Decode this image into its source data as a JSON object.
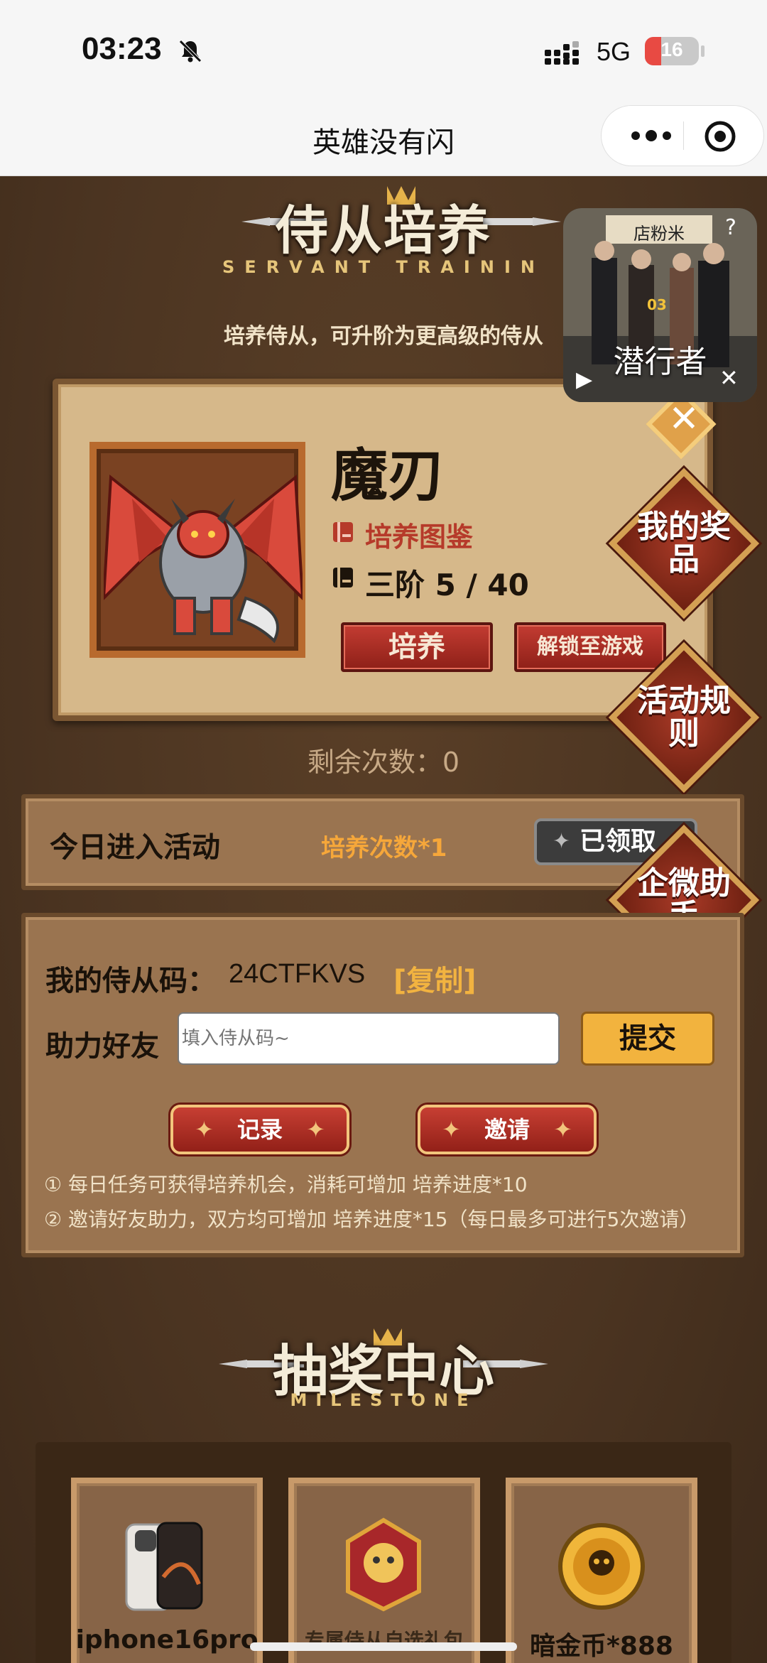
{
  "status": {
    "time": "03:23",
    "network": "5G",
    "battery": "16",
    "battery_level": 0.16
  },
  "nav": {
    "title": "英雄没有闪"
  },
  "header": {
    "title": "侍从培养",
    "subtitle": "SERVANT TRAININ",
    "intro": "培养侍从，可升阶为更高级的侍从"
  },
  "servant": {
    "name": "魔刃",
    "atlas_label": "培养图鉴",
    "rank": "三阶 5 / 40",
    "train_button": "培养",
    "unlock_button": "解锁至游戏"
  },
  "remaining": "剩余次数：0",
  "side_buttons": {
    "prizes": "我的奖品",
    "rules": "活动规则",
    "assistant": "企微助手"
  },
  "close_glyph": "✕",
  "today": {
    "label": "今日进入活动",
    "reward": "培养次数*1",
    "status": "已领取"
  },
  "help": {
    "code_label": "我的侍从码：",
    "code_value": "24CTFKVS",
    "copy_label": "[复制]",
    "friend_label": "助力好友",
    "input_placeholder": "填入侍从码~",
    "submit_label": "提交",
    "record_label": "记录",
    "invite_label": "邀请",
    "notes": [
      "① 每日任务可获得培养机会，消耗可增加 培养进度*10",
      "② 邀请好友助力，双方均可增加 培养进度*15（每日最多可进行5次邀请）"
    ]
  },
  "lottery": {
    "title": "抽奖中心",
    "subtitle": "MILESTONE",
    "prizes": [
      {
        "name": "iphone16pro"
      },
      {
        "name": "专属侍从自选礼包"
      },
      {
        "name": "暗金币*888"
      }
    ]
  },
  "video": {
    "title": "潜行者",
    "episode": "03",
    "sign": "店粉米"
  },
  "colors": {
    "accent_red": "#b63a2a",
    "gold": "#f2b33e",
    "panel": "#9a7450"
  }
}
